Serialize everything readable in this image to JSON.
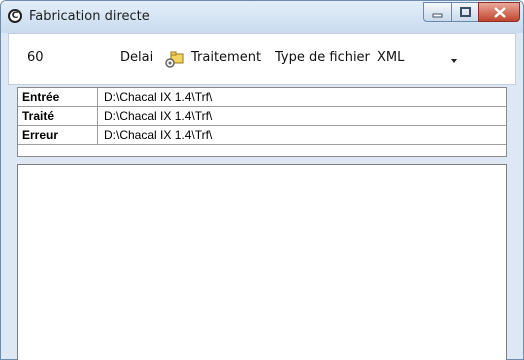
{
  "window": {
    "title": "Fabrication directe",
    "icon": "app-c-icon"
  },
  "toolbar": {
    "delay_value": "60",
    "delay_label": "Delai",
    "treatment_label": "Traitement",
    "file_type_label": "Type de fichier",
    "file_type_value": "XML"
  },
  "paths": [
    {
      "label": "Entrée",
      "value": "D:\\Chacal IX 1.4\\Trf\\"
    },
    {
      "label": "Traité",
      "value": "D:\\Chacal IX 1.4\\Trf\\"
    },
    {
      "label": "Erreur",
      "value": "D:\\Chacal IX 1.4\\Trf\\"
    }
  ],
  "colors": {
    "close_button": "#c2442c",
    "title_bar": "#c8dbef"
  }
}
